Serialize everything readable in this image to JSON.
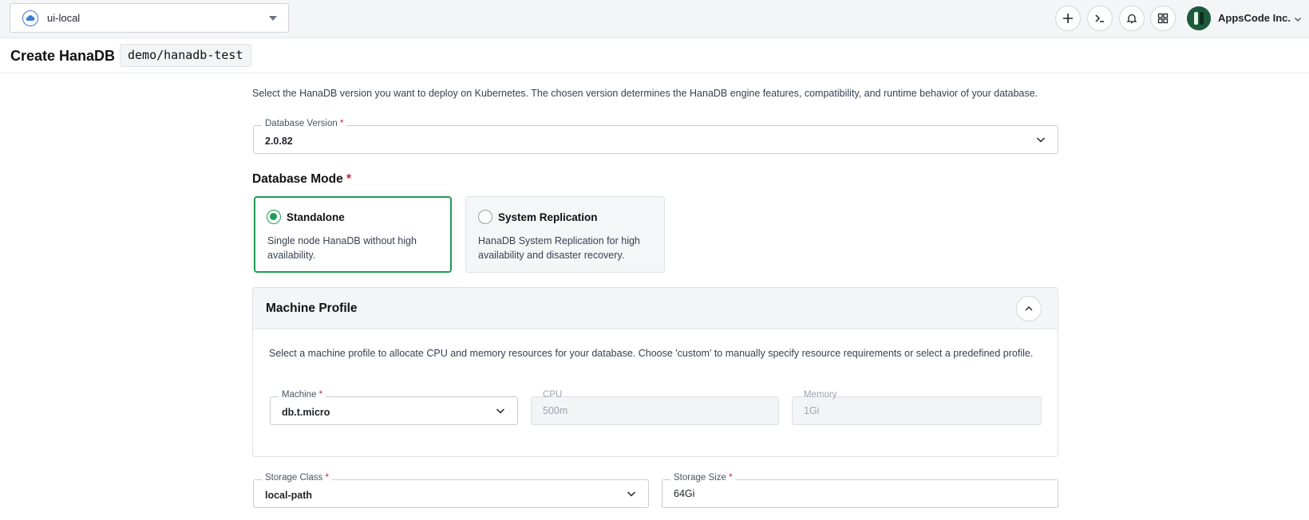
{
  "topbar": {
    "cluster_name": "ui-local",
    "user_name": "AppsCode Inc.",
    "icons": [
      "plus-icon",
      "terminal-icon",
      "bell-icon",
      "apps-grid-icon"
    ]
  },
  "header": {
    "title": "Create HanaDB :",
    "resource_name": "demo/hanadb-test"
  },
  "version_section": {
    "description": "Select the HanaDB version you want to deploy on Kubernetes. The chosen version determines the HanaDB engine features, compatibility, and runtime behavior of your database.",
    "label": "Database Version",
    "required": "*",
    "value": "2.0.82"
  },
  "mode_section": {
    "title": "Database Mode",
    "required": "*",
    "options": [
      {
        "title": "Standalone",
        "description": "Single node HanaDB without high availability.",
        "selected": true
      },
      {
        "title": "System Replication",
        "description": "HanaDB System Replication for high availability and disaster recovery.",
        "selected": false
      }
    ]
  },
  "machine_profile": {
    "title": "Machine Profile",
    "description": "Select a machine profile to allocate CPU and memory resources for your database. Choose 'custom' to manually specify resource requirements or select a predefined profile.",
    "machine_label": "Machine",
    "machine_required": "*",
    "machine_value": "db.t.micro",
    "cpu_label": "CPU",
    "cpu_value": "500m",
    "memory_label": "Memory",
    "memory_value": "1Gi"
  },
  "storage": {
    "class_label": "Storage Class",
    "class_required": "*",
    "class_value": "local-path",
    "size_label": "Storage Size",
    "size_required": "*",
    "size_value": "64Gi"
  },
  "colors": {
    "accent_green": "#1f9d55",
    "required_red": "#d11f3a"
  }
}
